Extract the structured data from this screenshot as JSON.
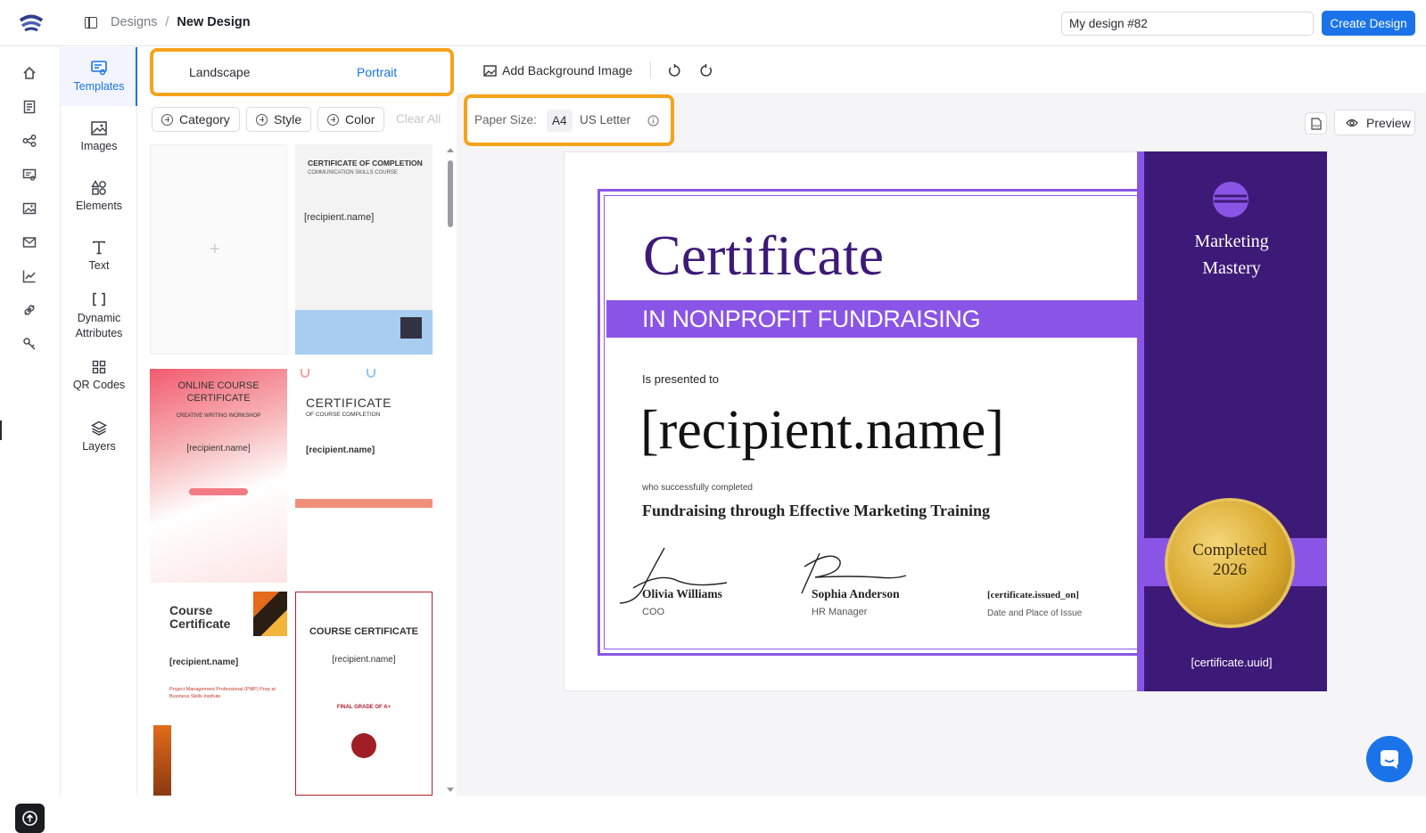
{
  "breadcrumb": {
    "root": "Designs",
    "separator": "/",
    "current": "New Design"
  },
  "design_name": "My design #82",
  "create_button": "Create Design",
  "panel_nav": [
    {
      "label": "Templates",
      "icon": "templates-icon",
      "active": true
    },
    {
      "label": "Images",
      "icon": "image-icon"
    },
    {
      "label": "Elements",
      "icon": "shapes-icon"
    },
    {
      "label": "Text",
      "icon": "text-icon"
    },
    {
      "label": "Dynamic Attributes",
      "icon": "brackets-icon"
    },
    {
      "label": "QR Codes",
      "icon": "qr-code-icon"
    },
    {
      "label": "Layers",
      "icon": "layers-icon"
    }
  ],
  "orientation": {
    "landscape": "Landscape",
    "portrait": "Portrait",
    "selected": "Portrait"
  },
  "filters": {
    "category": "Category",
    "style": "Style",
    "color": "Color",
    "clear": "Clear All"
  },
  "templates": {
    "t1": {
      "title": "CERTIFICATE OF COMPLETION",
      "sub": "COMMUNICATION SKILLS COURSE",
      "name": "[recipient.name]"
    },
    "t2": {
      "title": "ONLINE COURSE CERTIFICATE",
      "sub": "CREATIVE WRITING WORKSHOP",
      "name": "[recipient.name]"
    },
    "t3": {
      "title": "CERTIFICATE",
      "sub": "OF COURSE COMPLETION",
      "name": "[recipient.name]"
    },
    "t4": {
      "title": "Course Certificate",
      "name": "[recipient.name]",
      "detail": "Project Management Professional (PMP) Prep at Business Skills Institute"
    },
    "t5": {
      "title": "COURSE CERTIFICATE",
      "name": "[recipient.name]",
      "grade": "FINAL GRADE OF A+"
    }
  },
  "toolbar": {
    "background": "Add Background Image",
    "preview": "Preview"
  },
  "paper": {
    "label": "Paper Size:",
    "a4": "A4",
    "letter": "US Letter"
  },
  "certificate": {
    "title": "Certificate",
    "subtitle": "IN NONPROFIT FUNDRAISING",
    "presented": "Is presented to",
    "recipient": "[recipient.name]",
    "completed": "who successfully completed",
    "course": "Fundraising through Effective Marketing Training",
    "sig1_name": "Olivia Williams",
    "sig1_role": "COO",
    "sig2_name": "Sophia Anderson",
    "sig2_role": "HR Manager",
    "issued": "[certificate.issued_on]",
    "issued_label": "Date and Place of Issue",
    "brand_line1": "Marketing",
    "brand_line2": "Mastery",
    "seal_line1": "Completed",
    "seal_line2": "2026",
    "uuid": "[certificate.uuid]"
  },
  "colors": {
    "accent": "#1a73e8",
    "highlight": "#f5a31c",
    "cert_purple": "#8a55e6",
    "cert_dark": "#3d1a78"
  }
}
